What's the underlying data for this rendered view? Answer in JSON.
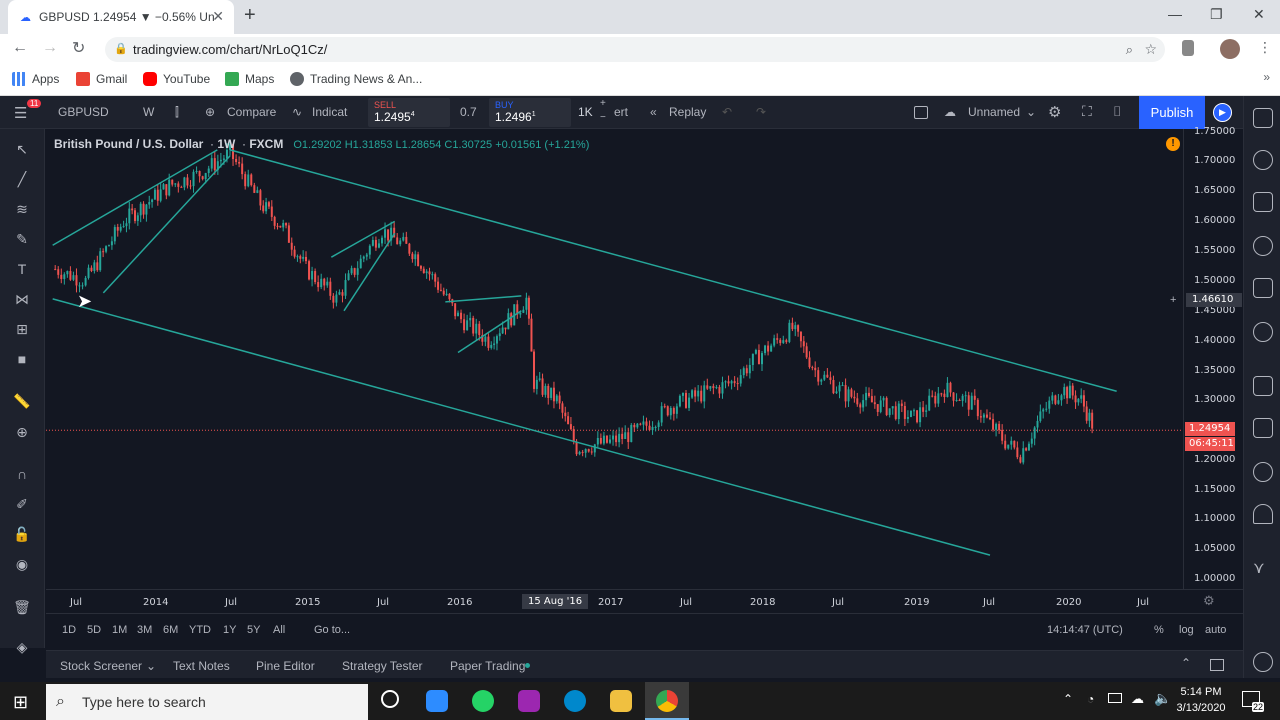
{
  "browser": {
    "tab_title": "GBPUSD 1.24954 ▼ −0.56% Unn",
    "url": "tradingview.com/chart/NrLoQ1Cz/",
    "bookmarks": [
      "Apps",
      "Gmail",
      "YouTube",
      "Maps",
      "Trading News & An..."
    ]
  },
  "toolbar": {
    "symbol": "GBPUSD",
    "interval": "W",
    "compare": "Compare",
    "indicators": "Indicat",
    "sell_label": "SELL",
    "sell_price": "1.2495",
    "sell_sup": "4",
    "spread": "0.7",
    "buy_label": "BUY",
    "buy_price": "1.2496",
    "buy_sup": "1",
    "quantity": "1K",
    "alert": "ert",
    "replay": "Replay",
    "layout_name": "Unnamed",
    "publish": "Publish",
    "badge": "11"
  },
  "legend": {
    "title": "British Pound / U.S. Dollar",
    "interval": "1W",
    "source": "FXCM",
    "ohlc": "O1.29202 H1.31853 L1.28654 C1.30725 +0.01561 (+1.21%)"
  },
  "price_axis": {
    "labels": [
      "1.75000",
      "1.70000",
      "1.65000",
      "1.60000",
      "1.55000",
      "1.50000",
      "1.45000",
      "1.40000",
      "1.35000",
      "1.30000",
      "1.25000",
      "1.20000",
      "1.15000",
      "1.10000",
      "1.05000",
      "1.00000"
    ],
    "crosshair_price": "1.46610",
    "last_price": "1.24954",
    "countdown": "06:45:11"
  },
  "time_axis": {
    "labels": [
      "Jul",
      "2014",
      "Jul",
      "2015",
      "Jul",
      "2016",
      "15 Aug '16",
      "2017",
      "Jul",
      "2018",
      "Jul",
      "2019",
      "Jul",
      "2020",
      "Jul"
    ]
  },
  "range_bar": {
    "ranges": [
      "1D",
      "5D",
      "1M",
      "3M",
      "6M",
      "YTD",
      "1Y",
      "5Y",
      "All"
    ],
    "goto": "Go to...",
    "clock": "14:14:47 (UTC)",
    "percent": "%",
    "log": "log",
    "auto": "auto"
  },
  "bottom_panel": {
    "tabs": [
      "Stock Screener",
      "Text Notes",
      "Pine Editor",
      "Strategy Tester",
      "Paper Trading"
    ]
  },
  "taskbar": {
    "search": "Type here to search",
    "time": "5:14 PM",
    "date": "3/13/2020",
    "notif": "22"
  },
  "chart_data": {
    "type": "candlestick",
    "symbol": "GBPUSD",
    "interval": "1W",
    "ylim": [
      1.0,
      1.75
    ],
    "last_price": 1.24954,
    "trendlines": [
      {
        "from": [
          "2013-05",
          1.56
        ],
        "to": [
          "2014-06",
          1.72
        ],
        "color": "#26a69a"
      },
      {
        "from": [
          "2013-09",
          1.48
        ],
        "to": [
          "2014-07",
          1.71
        ],
        "color": "#26a69a"
      },
      {
        "from": [
          "2014-07",
          1.72
        ],
        "to": [
          "2020-05",
          1.315
        ],
        "color": "#26a69a"
      },
      {
        "from": [
          "2013-05",
          1.47
        ],
        "to": [
          "2019-07",
          1.04
        ],
        "color": "#26a69a"
      },
      {
        "from": [
          "2015-03",
          1.54
        ],
        "to": [
          "2015-08",
          1.6
        ],
        "color": "#26a69a"
      },
      {
        "from": [
          "2015-04",
          1.45
        ],
        "to": [
          "2015-08",
          1.58
        ],
        "color": "#26a69a"
      },
      {
        "from": [
          "2015-12",
          1.465
        ],
        "to": [
          "2016-06",
          1.475
        ],
        "color": "#26a69a"
      },
      {
        "from": [
          "2016-01",
          1.38
        ],
        "to": [
          "2016-06",
          1.45
        ],
        "color": "#26a69a"
      }
    ],
    "path": [
      [
        2013.35,
        1.52
      ],
      [
        2013.55,
        1.5
      ],
      [
        2013.8,
        1.6
      ],
      [
        2014.1,
        1.66
      ],
      [
        2014.3,
        1.68
      ],
      [
        2014.5,
        1.715
      ],
      [
        2014.7,
        1.63
      ],
      [
        2014.85,
        1.59
      ],
      [
        2015.0,
        1.52
      ],
      [
        2015.2,
        1.47
      ],
      [
        2015.4,
        1.55
      ],
      [
        2015.5,
        1.585
      ],
      [
        2015.7,
        1.55
      ],
      [
        2015.85,
        1.5
      ],
      [
        2016.0,
        1.44
      ],
      [
        2016.2,
        1.4
      ],
      [
        2016.35,
        1.44
      ],
      [
        2016.45,
        1.47
      ],
      [
        2016.5,
        1.33
      ],
      [
        2016.65,
        1.3
      ],
      [
        2016.78,
        1.22
      ],
      [
        2017.0,
        1.23
      ],
      [
        2017.2,
        1.25
      ],
      [
        2017.4,
        1.29
      ],
      [
        2017.6,
        1.31
      ],
      [
        2017.8,
        1.33
      ],
      [
        2018.0,
        1.38
      ],
      [
        2018.2,
        1.42
      ],
      [
        2018.35,
        1.35
      ],
      [
        2018.55,
        1.31
      ],
      [
        2018.8,
        1.29
      ],
      [
        2019.0,
        1.27
      ],
      [
        2019.2,
        1.32
      ],
      [
        2019.4,
        1.29
      ],
      [
        2019.6,
        1.23
      ],
      [
        2019.7,
        1.21
      ],
      [
        2019.85,
        1.28
      ],
      [
        2019.97,
        1.32
      ],
      [
        2020.1,
        1.3
      ],
      [
        2020.19,
        1.25
      ]
    ]
  }
}
